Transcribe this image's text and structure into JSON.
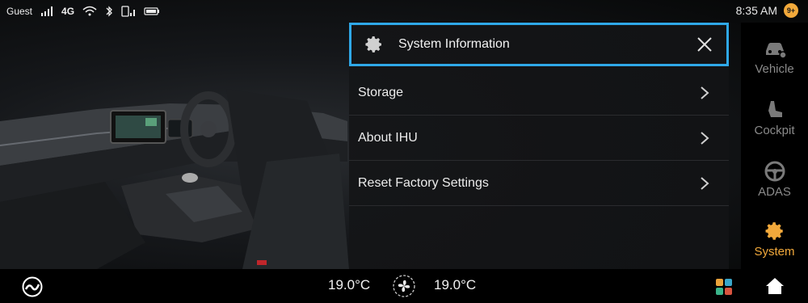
{
  "status_bar": {
    "user": "Guest",
    "network": "4G",
    "time": "8:35 AM",
    "notification_count": "9+"
  },
  "panel": {
    "title": "System Information",
    "items": [
      {
        "label": "Storage"
      },
      {
        "label": "About IHU"
      },
      {
        "label": "Reset Factory Settings"
      }
    ]
  },
  "nav": {
    "items": [
      {
        "label": "Vehicle",
        "icon": "car-settings-icon"
      },
      {
        "label": "Cockpit",
        "icon": "seat-icon"
      },
      {
        "label": "ADAS",
        "icon": "steering-wheel-icon"
      },
      {
        "label": "System",
        "icon": "gear-icon",
        "active": true
      }
    ]
  },
  "climate": {
    "left_temp": "19.0°C",
    "right_temp": "19.0°C"
  },
  "colors": {
    "accent": "#f2a93b",
    "highlight_border": "#2fa8e8"
  }
}
